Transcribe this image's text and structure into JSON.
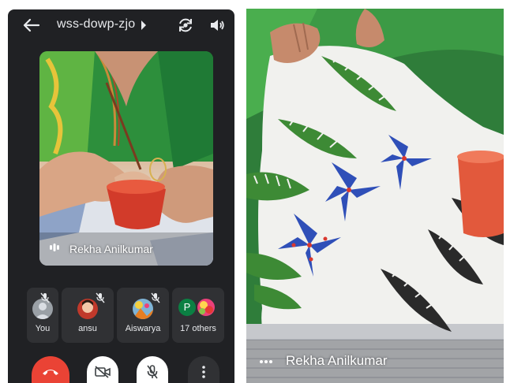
{
  "left_screen": {
    "meeting_code": "wss-dowp-zjo",
    "main_tile": {
      "participant_name": "Rekha Anilkumar"
    },
    "participants": [
      {
        "name": "You",
        "avatar": "photo-avatar",
        "muted": true
      },
      {
        "name": "ansu",
        "avatar": "photo-avatar",
        "muted": true
      },
      {
        "name": "Aiswarya",
        "avatar": "photo-avatar",
        "muted": true
      },
      {
        "name": "17 others",
        "avatar": "stacked-avatars",
        "initial": "P",
        "muted": false
      }
    ],
    "controls": [
      "end-call",
      "camera-off",
      "mic-off",
      "more-options"
    ],
    "icons": [
      "back-arrow-icon",
      "chevron-right-icon",
      "flip-camera-icon",
      "speaker-icon"
    ]
  },
  "right_screen": {
    "participant_name": "Rekha Anilkumar",
    "icons": [
      "more-horizontal-icon"
    ]
  },
  "colors": {
    "background": "#202124",
    "tile": "#303134",
    "end_call": "#ea4335",
    "control_button": "#ffffff",
    "text": "#e8eaed"
  }
}
